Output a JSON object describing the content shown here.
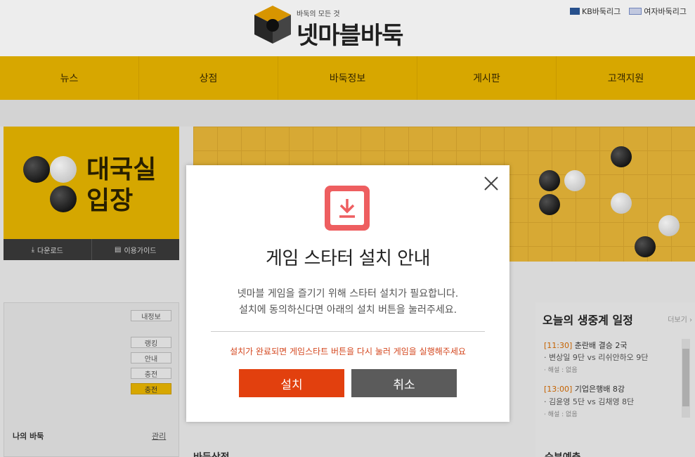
{
  "header": {
    "logo_sub": "바둑의 모든 것",
    "logo_main": "넷마블바둑",
    "links": [
      "KB바둑리그",
      "여자바둑리그"
    ]
  },
  "nav": [
    "뉴스",
    "상점",
    "바둑정보",
    "게시판",
    "고객지원"
  ],
  "enter_card": {
    "title_line1": "대국실",
    "title_line2": "입장",
    "download": "다운로드",
    "guide": "이용가이드"
  },
  "left_panel": {
    "btn_info": "내정보",
    "btn_ranking": "랭킹",
    "btn_guide": "안내",
    "btn_charge1": "충전",
    "btn_charge2": "충전",
    "my_baduk": "나의 바둑",
    "manage": "관리"
  },
  "schedule": {
    "title": "오늘의 생중계 일정",
    "more": "더보기",
    "items": [
      {
        "time": "[11:30]",
        "name": " 춘란배 결승 2국",
        "match": "· 변상일 9단 vs 리쉬안하오 9단",
        "note": "· 해설 : 없음"
      },
      {
        "time": "[13:00]",
        "name": " 기업은행배 8강",
        "match": "· 김윤영 5단 vs 김채영 8단",
        "note": "· 해설 : 없음"
      }
    ]
  },
  "sections": {
    "mid": "바둑상점",
    "right": "승부예측"
  },
  "modal": {
    "title": "게임 스타터 설치 안내",
    "desc_line1": "넷마블 게임을 즐기기 위해 스타터 설치가 필요합니다.",
    "desc_line2": "설치에 동의하신다면 아래의 설치 버튼을 눌러주세요.",
    "notice": "설치가 완료되면 게임스타트 버튼을 다시 눌러 게임을 실행해주세요",
    "install": "설치",
    "cancel": "취소"
  },
  "colors": {
    "accent_yellow": "#e8b400",
    "install_red": "#e2400e",
    "cancel_gray": "#5b5b5b",
    "download_icon": "#ee5e60"
  }
}
